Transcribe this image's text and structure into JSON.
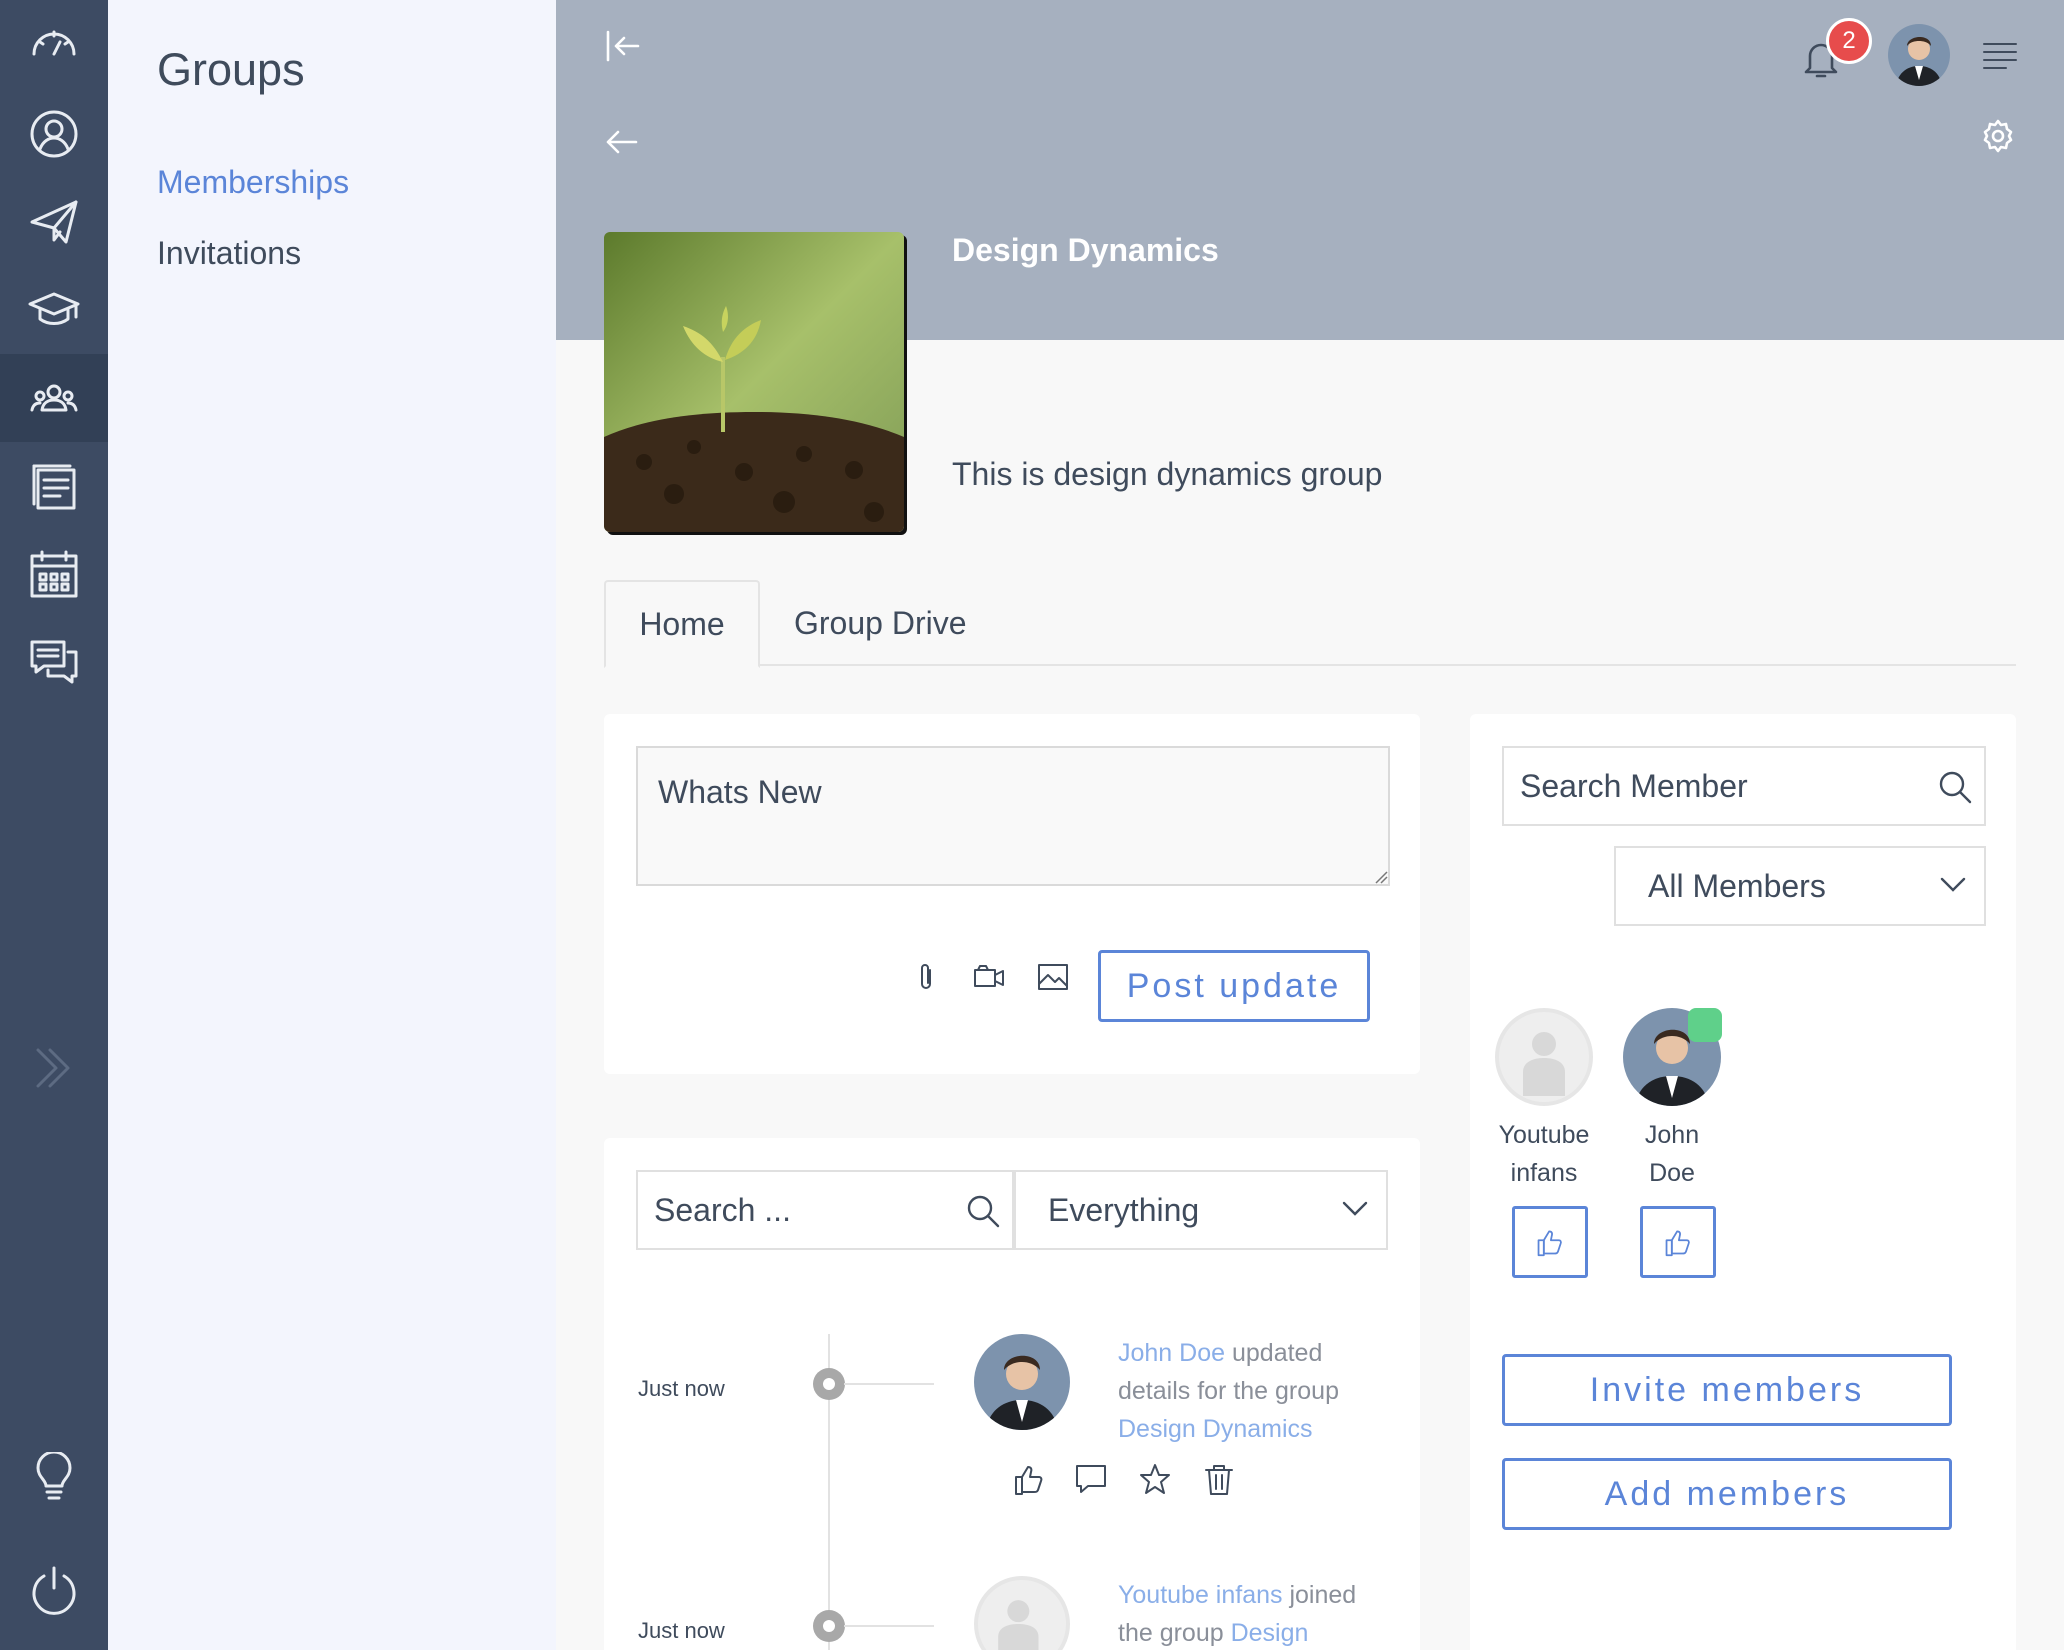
{
  "rail": {
    "items": [
      {
        "icon": "dashboard-gauge-icon",
        "active": false
      },
      {
        "icon": "profile-icon",
        "active": false
      },
      {
        "icon": "paper-plane-icon",
        "active": false
      },
      {
        "icon": "graduation-cap-icon",
        "active": false
      },
      {
        "icon": "groups-icon",
        "active": true
      },
      {
        "icon": "notes-icon",
        "active": false
      },
      {
        "icon": "calendar-icon",
        "active": false
      },
      {
        "icon": "chat-icon",
        "active": false
      }
    ],
    "expand_icon": "double-chevron-right-icon",
    "bottom": [
      "lightbulb-icon",
      "power-icon"
    ]
  },
  "subnav": {
    "title": "Groups",
    "items": [
      {
        "label": "Memberships",
        "active": true
      },
      {
        "label": "Invitations",
        "active": false
      }
    ]
  },
  "header": {
    "notification_count": "2",
    "banner_color": "#a6b0bf"
  },
  "group": {
    "name": "Design Dynamics",
    "description": "This is design dynamics group"
  },
  "tabs": [
    {
      "label": "Home",
      "active": true
    },
    {
      "label": "Group Drive",
      "active": false
    }
  ],
  "composer": {
    "placeholder": "Whats New",
    "post_label": "Post update"
  },
  "feed": {
    "search_placeholder": "Search ...",
    "filter_value": "Everything",
    "items": [
      {
        "time": "Just now",
        "actor": "John Doe",
        "text": " updated details for the group ",
        "target": "Design Dynamics"
      },
      {
        "time": "Just now",
        "actor": "Youtube infans",
        "text": " joined the group ",
        "target": "Design"
      }
    ]
  },
  "members": {
    "search_placeholder": "Search Member",
    "filter_value": "All Members",
    "list": [
      {
        "first": "Youtube",
        "last": "infans",
        "online": false
      },
      {
        "first": "John",
        "last": "Doe",
        "online": true
      }
    ],
    "invite_label": "Invite members",
    "add_label": "Add members"
  },
  "colors": {
    "accent": "#5b85d8",
    "rail": "#3d4b63",
    "online": "#5fd08a",
    "badge": "#e74c4c"
  }
}
